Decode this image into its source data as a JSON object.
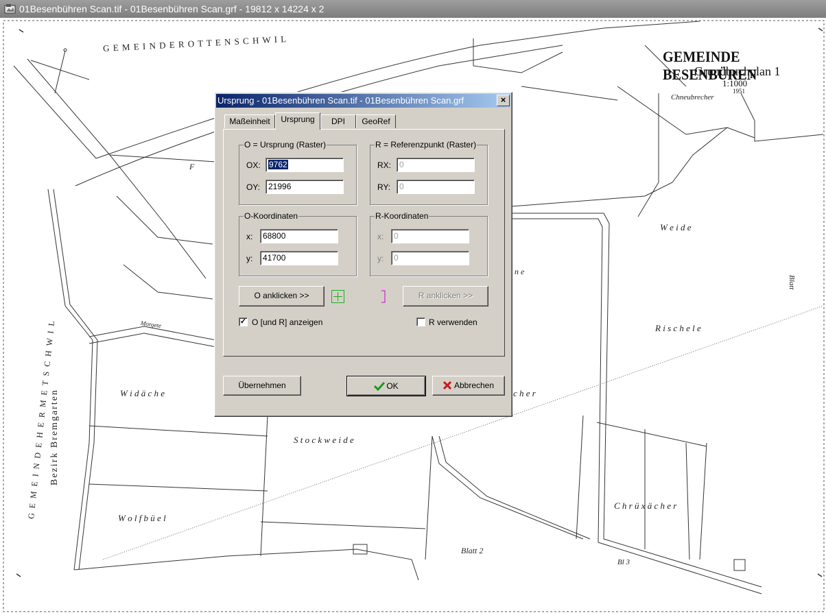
{
  "main_window": {
    "title": "01Besenbühren Scan.tif - 01Besenbühren Scan.grf - 19812 x 14224 x 2"
  },
  "map": {
    "title": "GEMEINDE BESENBÜREN",
    "subtitle": "Grundbuchplan 1",
    "scale": "1:1000",
    "year": "1951",
    "labels": {
      "rottenschwil": "G E M E I N D E    R O T T E N S C H W I L",
      "hermetschwil": "G E M E I N D E   H E R M E T S C H W I L",
      "bremgarten": "Bezirk Bremgarten",
      "chneubrecher": "Chneubrecher",
      "weide": "W e i d e",
      "rischele": "R i s c h e l e",
      "widacher": "W i d ä c h e",
      "stockweide": "S t o c k w e i d e",
      "wolfbuel": "W o l f b ü e l",
      "chruzacher": "C h r ü x ä c h e r",
      "cher": "c h e r",
      "blatt2": "Blatt 2",
      "blatt3": "Bl 3",
      "blatt_right": "Blatt",
      "morgete": "Morgete",
      "ne": "n e",
      "f": "F"
    }
  },
  "dialog": {
    "title": "Ursprung - 01Besenbühren Scan.tif - 01Besenbühren Scan.grf",
    "tabs": [
      "Maßeinheit",
      "Ursprung",
      "DPI",
      "GeoRef"
    ],
    "active_tab": "Ursprung",
    "group_o_raster": {
      "label": "O = Ursprung (Raster)",
      "ox_label": "OX:",
      "ox_value": "9762",
      "oy_label": "OY:",
      "oy_value": "21996"
    },
    "group_r_raster": {
      "label": "R = Referenzpunkt (Raster)",
      "rx_label": "RX:",
      "rx_value": "0",
      "ry_label": "RY:",
      "ry_value": "0"
    },
    "group_o_coord": {
      "label": "O-Koordinaten",
      "x_label": "x:",
      "x_value": "68800",
      "y_label": "y:",
      "y_value": "41700"
    },
    "group_r_coord": {
      "label": "R-Koordinaten",
      "x_label": "x:",
      "x_value": "0",
      "y_label": "y:",
      "y_value": "0"
    },
    "o_click_label": "O anklicken >>",
    "r_click_label": "R anklicken >>",
    "show_or_label": "O [und R] anzeigen",
    "show_or_checked": true,
    "use_r_label": "R verwenden",
    "use_r_checked": false,
    "apply_label": "Übernehmen",
    "ok_label": "OK",
    "cancel_label": "Abbrechen",
    "close_label": "×"
  },
  "colors": {
    "titlebar_active": "#0a246a",
    "dialog_face": "#d4d0c8",
    "ok_check": "#1a9a1a",
    "cancel_x": "#cc1a1a",
    "o_marker": "#22aa22",
    "r_marker": "#cc00cc"
  },
  "icons": [
    "app-icon",
    "close-icon",
    "checkmark-icon",
    "cancel-x-icon",
    "o-marker-icon",
    "r-marker-icon"
  ]
}
